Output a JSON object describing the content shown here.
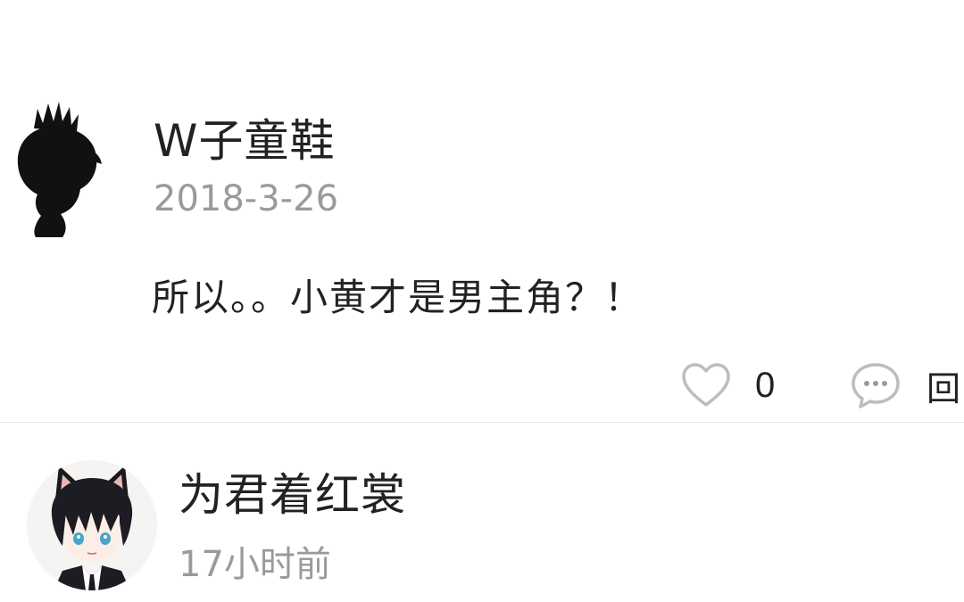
{
  "comments": [
    {
      "username": "W子童鞋",
      "timestamp": "2018-3-26",
      "text": "所以。。小黄才是男主角？！",
      "like_count": "0",
      "reply_label": "回"
    },
    {
      "username": "为君着红裳",
      "timestamp": "17小时前"
    }
  ],
  "icons": {
    "like": "heart-outline-icon",
    "reply": "comment-bubble-icon"
  },
  "colors": {
    "text": "#222222",
    "meta": "#9a9a9a",
    "icon": "#bdbdbd",
    "divider": "#e4e4e4"
  }
}
